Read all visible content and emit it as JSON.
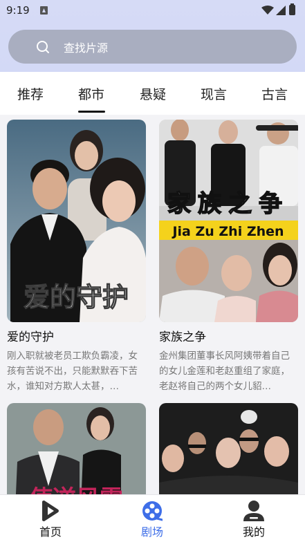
{
  "status_bar": {
    "time": "9:19"
  },
  "search": {
    "placeholder": "查找片源"
  },
  "tabs": [
    {
      "label": "推荐"
    },
    {
      "label": "都市"
    },
    {
      "label": "悬疑"
    },
    {
      "label": "现言"
    },
    {
      "label": "古言"
    }
  ],
  "active_tab": "都市",
  "dramas": [
    {
      "title": "爱的守护",
      "poster_text": "爱的守护",
      "description": "刚入职就被老员工欺负霸凌，女孩有苦说不出，只能默默吞下苦水，谁知对方欺人太甚，…"
    },
    {
      "title": "家族之争",
      "poster_text": "家族之争",
      "poster_subtitle": "Jia Zu Zhi Zhen",
      "description": "金州集团董事长风阿姨带着自己的女儿金莲和老赵重组了家庭，老赵将自己的两个女儿貂…"
    },
    {
      "poster_text": "使逆风雷"
    },
    {
      "poster_text": ""
    }
  ],
  "bottom_nav": {
    "items": [
      {
        "label": "首页",
        "icon": "play-icon"
      },
      {
        "label": "剧场",
        "icon": "film-reel-icon"
      },
      {
        "label": "我的",
        "icon": "person-icon"
      }
    ],
    "active": "剧场",
    "active_color": "#3e6ee8"
  }
}
